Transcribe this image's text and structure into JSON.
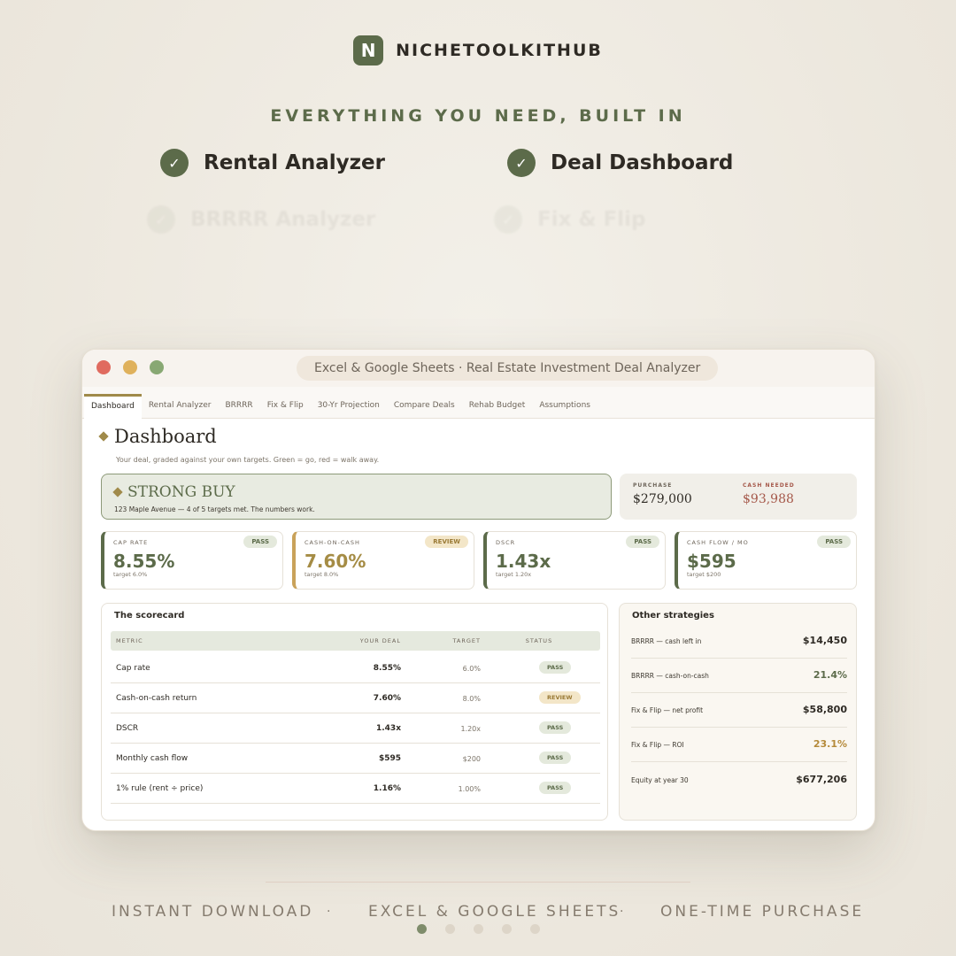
{
  "brand": {
    "logo_letter": "N",
    "name": "NICHETOOLKITHUB"
  },
  "tagline": "EVERYTHING YOU NEED, BUILT IN",
  "features": [
    "Rental Analyzer",
    "Deal Dashboard",
    "BRRRR Analyzer",
    "Fix & Flip"
  ],
  "window": {
    "title": "Excel & Google Sheets  ·  Real Estate Investment Deal Analyzer",
    "tabs": [
      "Dashboard",
      "Rental Analyzer",
      "BRRRR",
      "Fix & Flip",
      "30-Yr Projection",
      "Compare Deals",
      "Rehab Budget",
      "Assumptions"
    ]
  },
  "dashboard": {
    "title": "Dashboard",
    "subtitle": "Your deal, graded against your own targets. Green = go, red = walk away.",
    "verdict": {
      "title": "STRONG BUY",
      "subtitle": "123 Maple Avenue — 4 of 5 targets met. The numbers work."
    },
    "purchase_label": "PURCHASE",
    "purchase_value": "$279,000",
    "cash_label": "CASH NEEDED",
    "cash_value": "$93,988",
    "kpis": [
      {
        "label": "CAP RATE",
        "badge": "PASS",
        "value": "8.55%",
        "target": "target 6.0%"
      },
      {
        "label": "CASH-ON-CASH",
        "badge": "REVIEW",
        "value": "7.60%",
        "target": "target 8.0%"
      },
      {
        "label": "DSCR",
        "badge": "PASS",
        "value": "1.43x",
        "target": "target 1.20x"
      },
      {
        "label": "CASH FLOW / MO",
        "badge": "PASS",
        "value": "$595",
        "target": "target $200"
      }
    ],
    "scorecard": {
      "title": "The scorecard",
      "headers": {
        "metric": "METRIC",
        "yours": "YOUR DEAL",
        "target": "TARGET",
        "status": "STATUS"
      },
      "rows": [
        {
          "metric": "Cap rate",
          "yours": "8.55%",
          "target": "6.0%",
          "status": "PASS"
        },
        {
          "metric": "Cash-on-cash return",
          "yours": "7.60%",
          "target": "8.0%",
          "status": "REVIEW"
        },
        {
          "metric": "DSCR",
          "yours": "1.43x",
          "target": "1.20x",
          "status": "PASS"
        },
        {
          "metric": "Monthly cash flow",
          "yours": "$595",
          "target": "$200",
          "status": "PASS"
        },
        {
          "metric": "1% rule (rent ÷ price)",
          "yours": "1.16%",
          "target": "1.00%",
          "status": "PASS"
        }
      ]
    },
    "strategies": {
      "title": "Other strategies",
      "rows": [
        {
          "label": "BRRRR — cash left in",
          "value": "$14,450"
        },
        {
          "label": "BRRRR — cash-on-cash",
          "value": "21.4%"
        },
        {
          "label": "Fix & Flip — net profit",
          "value": "$58,800"
        },
        {
          "label": "Fix & Flip — ROI",
          "value": "23.1%"
        },
        {
          "label": "Equity at year 30",
          "value": "$677,206"
        }
      ]
    }
  },
  "footer": [
    "INSTANT DOWNLOAD",
    "EXCEL & GOOGLE SHEETS",
    "ONE-TIME PURCHASE"
  ],
  "footer_separator": "·",
  "colors": {
    "accent_green": "#5c6b4a",
    "accent_gold": "#a08a4a",
    "warn": "#a5584a",
    "background": "#efebe2"
  }
}
